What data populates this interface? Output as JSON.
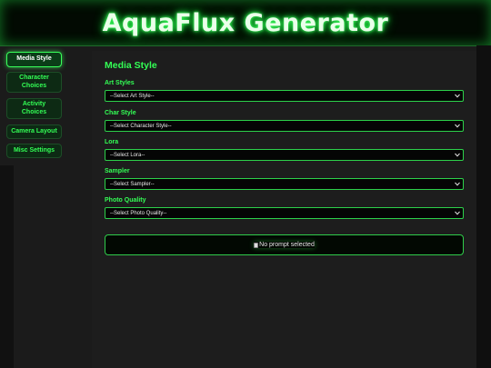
{
  "app": {
    "title": "AquaFlux Generator"
  },
  "sidebar": {
    "items": [
      {
        "label": "Media Style",
        "active": true
      },
      {
        "label": "Character Choices",
        "active": false
      },
      {
        "label": "Activity Choices",
        "active": false
      },
      {
        "label": "Camera Layout",
        "active": false
      },
      {
        "label": "Misc Settings",
        "active": false
      }
    ]
  },
  "main": {
    "title": "Media Style",
    "fields": [
      {
        "label": "Art Styles",
        "selected": "--Select Art Style--"
      },
      {
        "label": "Char Style",
        "selected": "--Select Character Style--"
      },
      {
        "label": "Lora",
        "selected": "--Select Lora--"
      },
      {
        "label": "Sampler",
        "selected": "--Select Sampler--"
      },
      {
        "label": "Photo Quality",
        "selected": "--Select Photo Quality--"
      }
    ],
    "prompt_image_alt": "No prompt selected"
  },
  "colors": {
    "accent": "#33ff55",
    "header_bg": "#020a02",
    "content_bg": "#1d1d1d",
    "page_bg": "#1b1b1b"
  },
  "icons": [
    "chevron-down-icon",
    "broken-image-icon"
  ]
}
